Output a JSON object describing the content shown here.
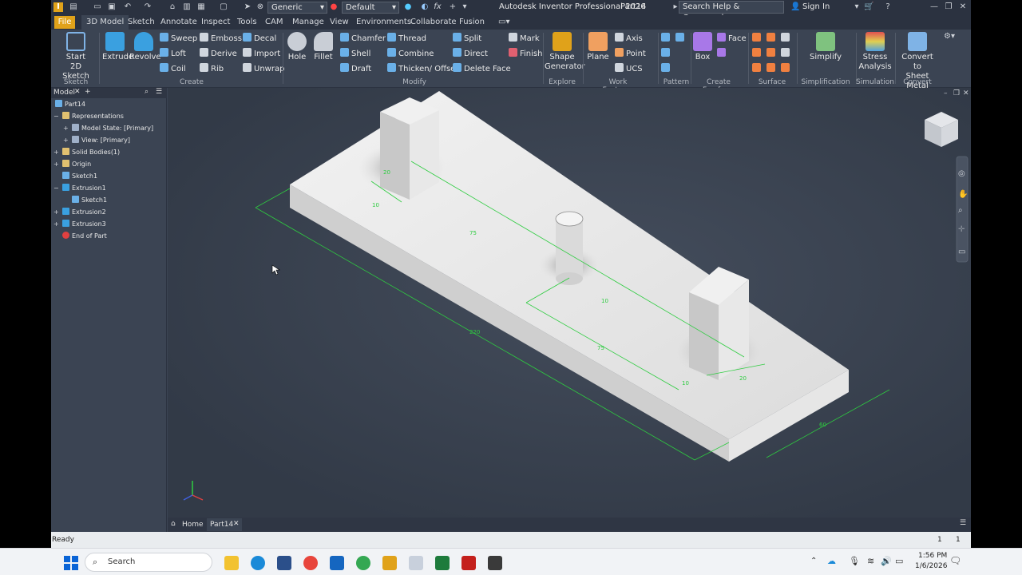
{
  "window": {
    "app_title": "Autodesk Inventor Professional 2026",
    "doc_title": "Part14",
    "search_placeholder": "Search Help & Commands...",
    "sign_in": "Sign In",
    "material_combo": "Generic",
    "appearance_combo": "Default"
  },
  "menu": {
    "file": "File",
    "tabs": [
      "3D Model",
      "Sketch",
      "Annotate",
      "Inspect",
      "Tools",
      "CAM",
      "Manage",
      "View",
      "Environments",
      "Collaborate",
      "Fusion"
    ]
  },
  "ribbon": {
    "sketch": {
      "start": "Start",
      "start2": "2D Sketch",
      "group": "Sketch"
    },
    "create": {
      "extrude": "Extrude",
      "revolve": "Revolve",
      "sweep": "Sweep",
      "emboss": "Emboss",
      "decal": "Decal",
      "loft": "Loft",
      "derive": "Derive",
      "import": "Import",
      "coil": "Coil",
      "rib": "Rib",
      "unwrap": "Unwrap",
      "group": "Create"
    },
    "modify": {
      "hole": "Hole",
      "fillet": "Fillet",
      "chamfer": "Chamfer",
      "thread": "Thread",
      "split": "Split",
      "shell": "Shell",
      "combine": "Combine",
      "direct": "Direct",
      "draft": "Draft",
      "thicken": "Thicken/ Offset",
      "delete_face": "Delete Face",
      "group": "Modify"
    },
    "explore": {
      "shape": "Shape",
      "shape2": "Generator",
      "group": "Explore"
    },
    "work": {
      "plane": "Plane",
      "axis": "Axis",
      "point": "Point",
      "ucs": "UCS",
      "group": "Work Features"
    },
    "pattern": {
      "group": "Pattern"
    },
    "freeform": {
      "box": "Box",
      "face": "Face",
      "group": "Create Freeform"
    },
    "surface": {
      "group": "Surface"
    },
    "simplification": {
      "simplify": "Simplify",
      "group": "Simplification"
    },
    "simulation": {
      "stress": "Stress",
      "stress2": "Analysis",
      "group": "Simulation"
    },
    "convert": {
      "label": "Convert to",
      "label2": "Sheet Metal",
      "group": "Convert"
    },
    "mark": "Mark",
    "finish": "Finish"
  },
  "browser": {
    "tab": "Model",
    "items": [
      {
        "label": "Part14",
        "level": 0,
        "exp": ""
      },
      {
        "label": "Representations",
        "level": 1,
        "exp": "−"
      },
      {
        "label": "Model State: [Primary]",
        "level": 2,
        "exp": "+"
      },
      {
        "label": "View: [Primary]",
        "level": 2,
        "exp": "+"
      },
      {
        "label": "Solid Bodies(1)",
        "level": 1,
        "exp": "+"
      },
      {
        "label": "Origin",
        "level": 1,
        "exp": "+"
      },
      {
        "label": "Sketch1",
        "level": 1,
        "exp": ""
      },
      {
        "label": "Extrusion1",
        "level": 1,
        "exp": "−"
      },
      {
        "label": "Sketch1",
        "level": 2,
        "exp": ""
      },
      {
        "label": "Extrusion2",
        "level": 1,
        "exp": "+"
      },
      {
        "label": "Extrusion3",
        "level": 1,
        "exp": "+"
      },
      {
        "label": "End of Part",
        "level": 1,
        "exp": ""
      }
    ]
  },
  "dimensions": {
    "d20a": "20",
    "d10a": "10",
    "d75a": "75",
    "d10b": "10",
    "d220": "220",
    "d75b": "75",
    "d10c": "10",
    "d20b": "20",
    "d60": "60"
  },
  "doc_tabs": {
    "home": "Home",
    "part": "Part14"
  },
  "status": {
    "text": "Ready",
    "n1": "1",
    "n2": "1"
  },
  "taskbar": {
    "search": "Search",
    "time": "1:56 PM",
    "date": "1/6/2026"
  },
  "colors": {
    "accent": "#e0a21a",
    "dimension": "#2ecc40",
    "bg": "#3b4453"
  }
}
